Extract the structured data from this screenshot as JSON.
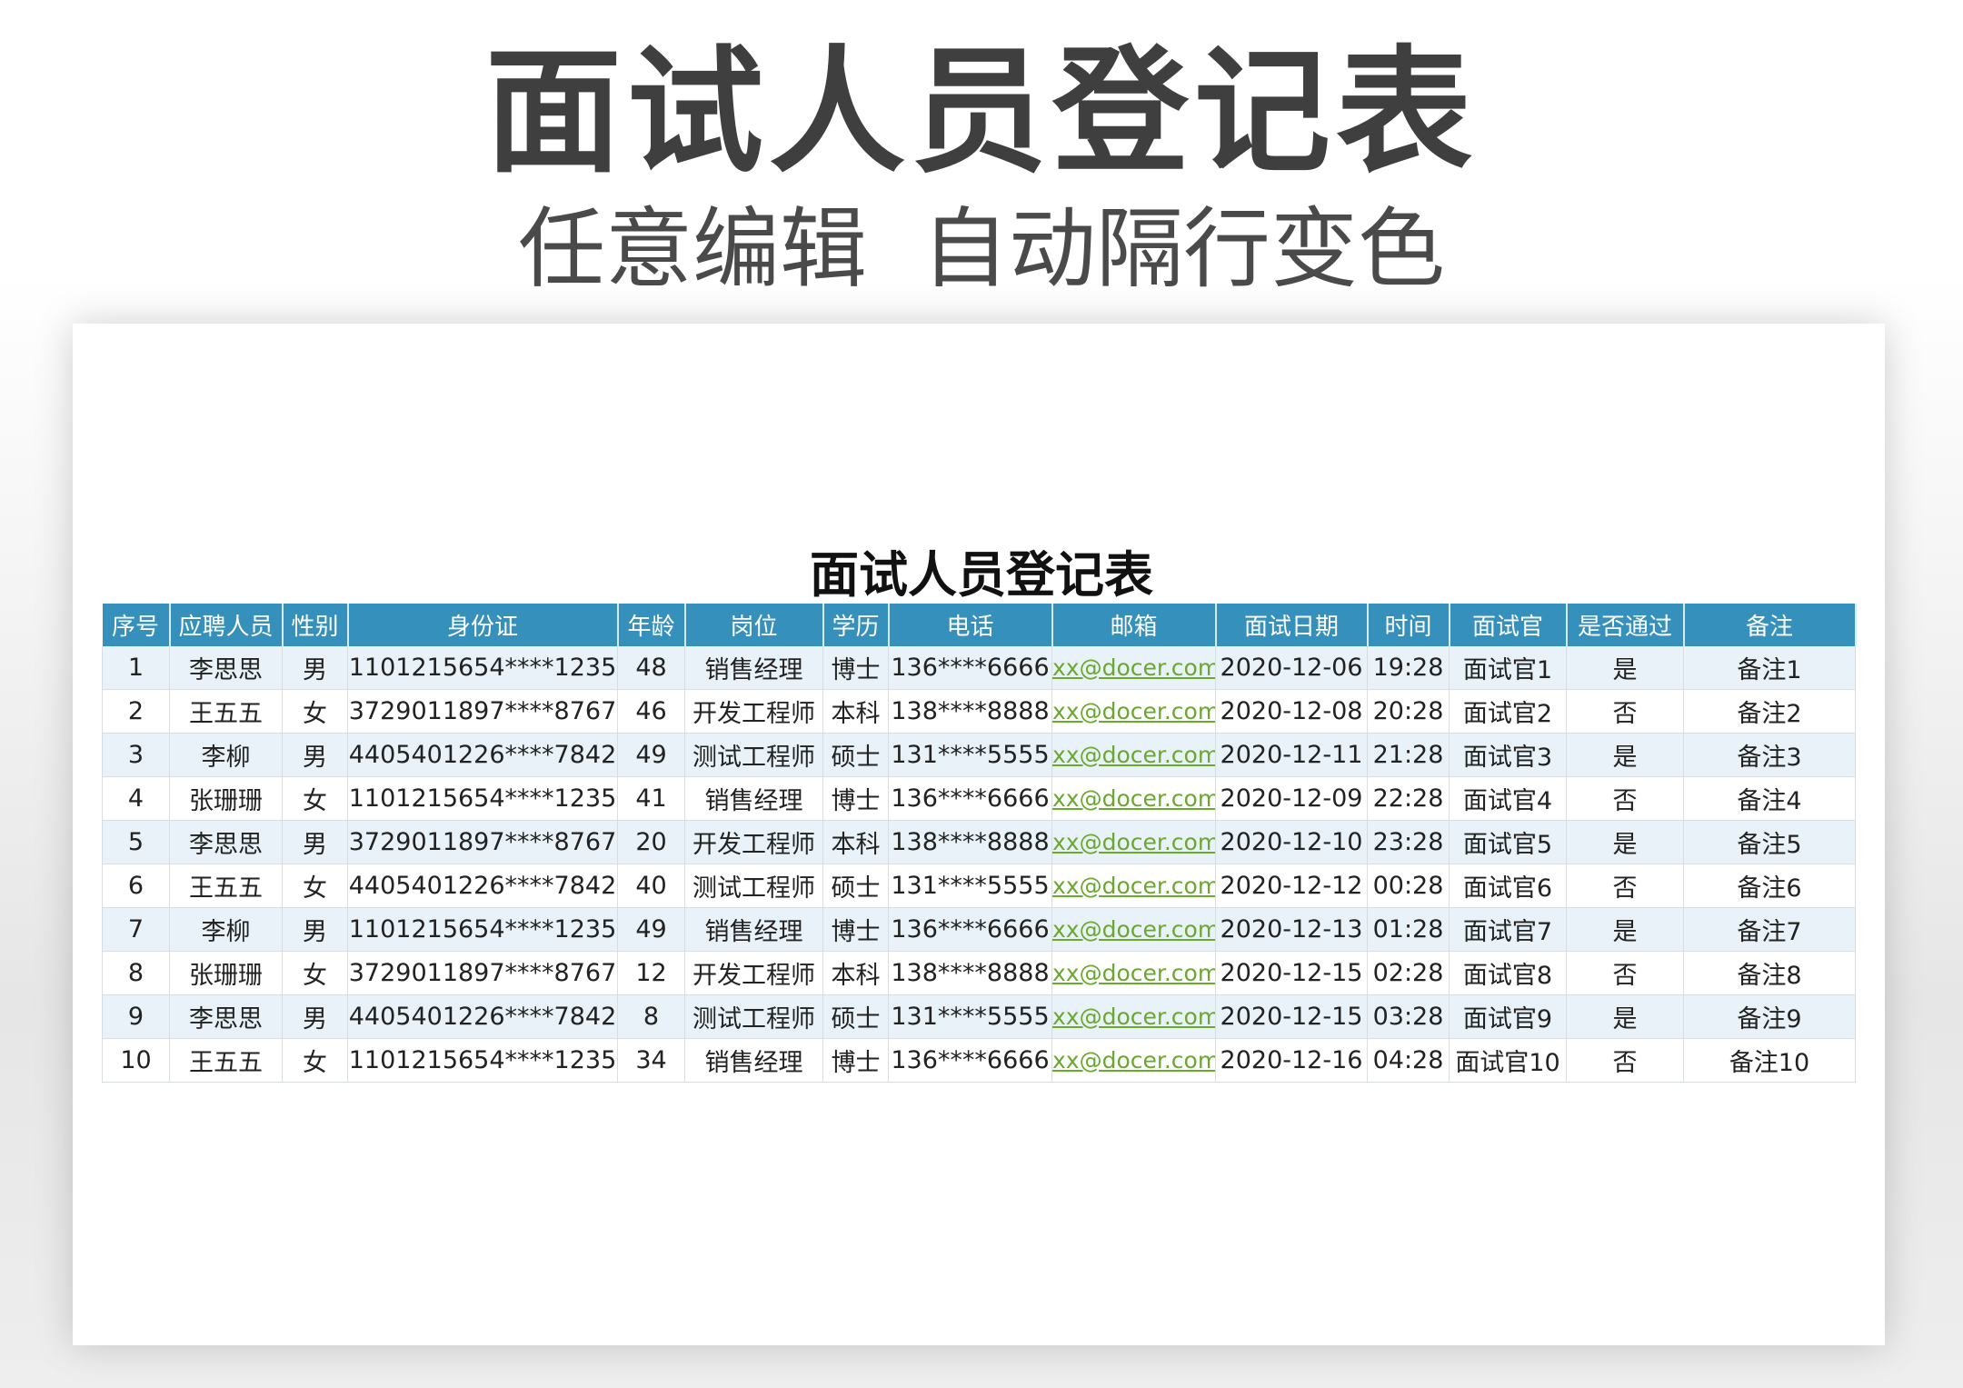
{
  "hero": {
    "title": "面试人员登记表",
    "subtitle_part1": "任意编辑",
    "subtitle_part2": "自动隔行变色"
  },
  "sheet": {
    "title": "面试人员登记表",
    "headers": [
      "序号",
      "应聘人员",
      "性别",
      "身份证",
      "年龄",
      "岗位",
      "学历",
      "电话",
      "邮箱",
      "面试日期",
      "时间",
      "面试官",
      "是否通过",
      "备注"
    ],
    "rows": [
      [
        "1",
        "李思思",
        "男",
        "1101215654****1235",
        "48",
        "销售经理",
        "博士",
        "136****6666",
        "xx@docer.com",
        "2020-12-06",
        "19:28",
        "面试官1",
        "是",
        "备注1"
      ],
      [
        "2",
        "王五五",
        "女",
        "3729011897****8767",
        "46",
        "开发工程师",
        "本科",
        "138****8888",
        "xx@docer.com",
        "2020-12-08",
        "20:28",
        "面试官2",
        "否",
        "备注2"
      ],
      [
        "3",
        "李柳",
        "男",
        "4405401226****7842",
        "49",
        "测试工程师",
        "硕士",
        "131****5555",
        "xx@docer.com",
        "2020-12-11",
        "21:28",
        "面试官3",
        "是",
        "备注3"
      ],
      [
        "4",
        "张珊珊",
        "女",
        "1101215654****1235",
        "41",
        "销售经理",
        "博士",
        "136****6666",
        "xx@docer.com",
        "2020-12-09",
        "22:28",
        "面试官4",
        "否",
        "备注4"
      ],
      [
        "5",
        "李思思",
        "男",
        "3729011897****8767",
        "20",
        "开发工程师",
        "本科",
        "138****8888",
        "xx@docer.com",
        "2020-12-10",
        "23:28",
        "面试官5",
        "是",
        "备注5"
      ],
      [
        "6",
        "王五五",
        "女",
        "4405401226****7842",
        "40",
        "测试工程师",
        "硕士",
        "131****5555",
        "xx@docer.com",
        "2020-12-12",
        "00:28",
        "面试官6",
        "否",
        "备注6"
      ],
      [
        "7",
        "李柳",
        "男",
        "1101215654****1235",
        "49",
        "销售经理",
        "博士",
        "136****6666",
        "xx@docer.com",
        "2020-12-13",
        "01:28",
        "面试官7",
        "是",
        "备注7"
      ],
      [
        "8",
        "张珊珊",
        "女",
        "3729011897****8767",
        "12",
        "开发工程师",
        "本科",
        "138****8888",
        "xx@docer.com",
        "2020-12-15",
        "02:28",
        "面试官8",
        "否",
        "备注8"
      ],
      [
        "9",
        "李思思",
        "男",
        "4405401226****7842",
        "8",
        "测试工程师",
        "硕士",
        "131****5555",
        "xx@docer.com",
        "2020-12-15",
        "03:28",
        "面试官9",
        "是",
        "备注9"
      ],
      [
        "10",
        "王五五",
        "女",
        "1101215654****1235",
        "34",
        "销售经理",
        "博士",
        "136****6666",
        "xx@docer.com",
        "2020-12-16",
        "04:28",
        "面试官10",
        "否",
        "备注10"
      ]
    ]
  },
  "colors": {
    "header_bg": "#3690bc",
    "stripe_bg": "#e8f2f8",
    "email_text": "#6aa82e"
  }
}
